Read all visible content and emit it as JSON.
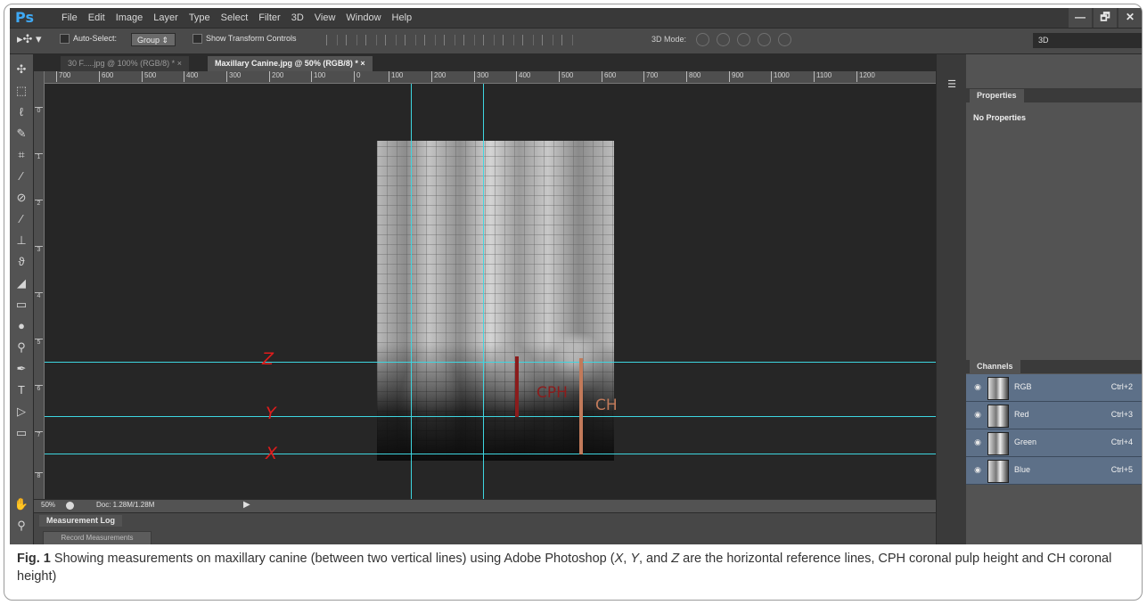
{
  "app": {
    "logo": "Ps",
    "menu": [
      "File",
      "Edit",
      "Image",
      "Layer",
      "Type",
      "Select",
      "Filter",
      "3D",
      "View",
      "Window",
      "Help"
    ],
    "window_buttons": [
      "—",
      "🗗",
      "✕"
    ]
  },
  "options": {
    "auto_select_label": "Auto-Select:",
    "group_select": "Group",
    "show_transform_label": "Show Transform Controls",
    "mode_3d_label": "3D Mode:",
    "workspace_select": "3D"
  },
  "tabs": [
    {
      "label": "30 F.....jpg @ 100% (RGB/8) *",
      "active": false
    },
    {
      "label": "Maxillary Canine.jpg @ 50% (RGB/8) *",
      "active": true
    }
  ],
  "ruler_top_ticks": [
    "700",
    "600",
    "500",
    "400",
    "300",
    "200",
    "100",
    "0",
    "100",
    "200",
    "300",
    "400",
    "500",
    "600",
    "700",
    "800",
    "900",
    "1000",
    "1100",
    "1200"
  ],
  "ruler_left_ticks": [
    "0",
    "1",
    "2",
    "3",
    "4",
    "5",
    "6",
    "7",
    "8"
  ],
  "canvas": {
    "reference_lines": [
      "Z",
      "Y",
      "X"
    ],
    "cph_label": "CPH",
    "ch_label": "CH"
  },
  "status": {
    "zoom": "50%",
    "doc": "Doc: 1.28M/1.28M"
  },
  "measurement_log": {
    "title": "Measurement Log",
    "record_button": "Record Measurements"
  },
  "properties": {
    "tab": "Properties",
    "body": "No Properties"
  },
  "channels": {
    "tab": "Channels",
    "items": [
      {
        "name": "RGB",
        "shortcut": "Ctrl+2"
      },
      {
        "name": "Red",
        "shortcut": "Ctrl+3"
      },
      {
        "name": "Green",
        "shortcut": "Ctrl+4"
      },
      {
        "name": "Blue",
        "shortcut": "Ctrl+5"
      }
    ]
  },
  "caption": {
    "fig": "Fig. 1",
    "text_a": " Showing measurements on maxillary canine (between two vertical lines) using Adobe Photoshop (",
    "x": "X",
    "sep1": ", ",
    "y": "Y",
    "sep2": ", and ",
    "z": "Z",
    "text_b": " are the horizontal reference lines, CPH coronal pulp height and CH coronal height)"
  },
  "colors": {
    "guide": "#3ed6e0",
    "cph": "#8b1c1c",
    "ch": "#c27a5a",
    "axis_label": "#e01c1c",
    "channel_highlight": "#5d7088"
  }
}
